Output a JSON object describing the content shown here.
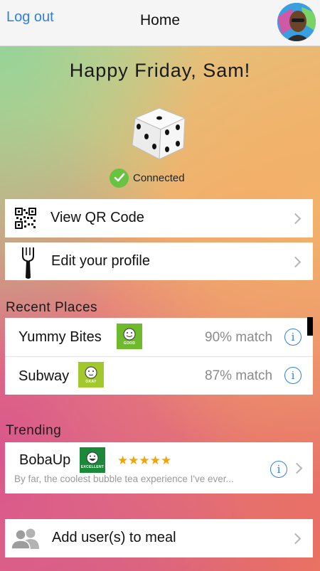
{
  "nav": {
    "logout_label": "Log out",
    "title": "Home"
  },
  "greeting": "Happy Friday, Sam!",
  "status": {
    "label": "Connected",
    "color": "#68c340"
  },
  "menu": [
    {
      "label": "View QR Code",
      "icon": "qr-code-icon"
    },
    {
      "label": "Edit your profile",
      "icon": "fork-icon"
    }
  ],
  "recent_places": {
    "heading": "Recent Places",
    "items": [
      {
        "name": "Yummy Bites",
        "rating": "GOOD",
        "rating_color": "#6fba2c",
        "match": "90% match"
      },
      {
        "name": "Subway",
        "rating": "OKAY",
        "rating_color": "#a3c82d",
        "match": "87% match"
      }
    ]
  },
  "trending": {
    "heading": "Trending",
    "items": [
      {
        "name": "BobaUp",
        "rating": "EXCELLENT",
        "rating_color": "#1a8a3a",
        "stars": "★★★★★",
        "review": "By far, the coolest bubble tea experience I've ever..."
      }
    ]
  },
  "add_users": {
    "label": "Add user(s) to meal",
    "icon": "users-icon"
  },
  "accent_color": "#2f7fe0"
}
